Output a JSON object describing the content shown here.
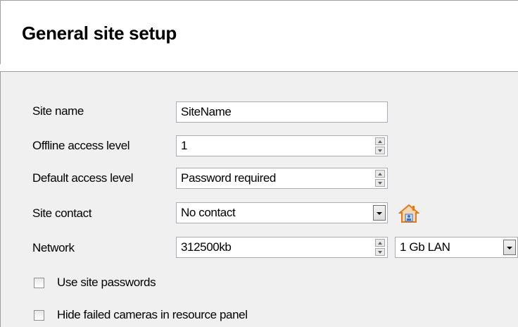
{
  "header": {
    "title": "General site setup"
  },
  "form": {
    "site_name": {
      "label": "Site name",
      "value": "SiteName"
    },
    "offline_access_level": {
      "label": "Offline access level",
      "value": "1"
    },
    "default_access_level": {
      "label": "Default access level",
      "value": "Password required"
    },
    "site_contact": {
      "label": "Site contact",
      "value": "No contact",
      "icon": "house-contact-icon"
    },
    "network": {
      "label": "Network",
      "value": "312500kb",
      "type_value": "1 Gb LAN"
    },
    "use_site_passwords": {
      "label": "Use site passwords",
      "checked": false
    },
    "hide_failed_cameras": {
      "label": "Hide failed cameras in resource panel",
      "checked": false
    }
  },
  "colors": {
    "panel_bg": "#f0f0f0",
    "field_border": "#abadb3",
    "icon_orange": "#e07a1f",
    "icon_blue": "#3a6fc4"
  }
}
